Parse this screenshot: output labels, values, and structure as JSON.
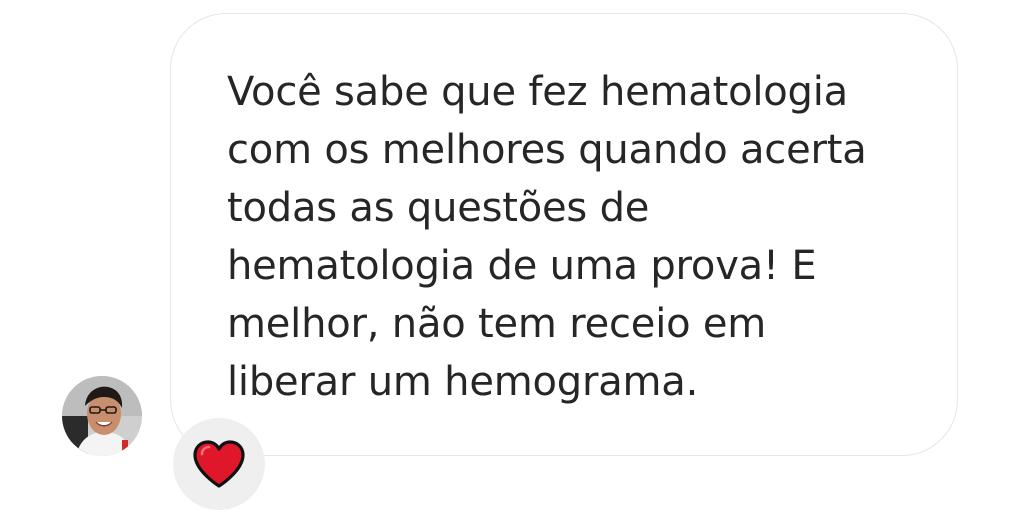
{
  "message": {
    "text": "Você sabe que fez hematologia\ncom os melhores quando acerta\ntodas as questões de\nhematologia de uma prova! E\nmelhor, não tem receio em\nliberar um hemograma.",
    "reaction_icon": "heart-icon",
    "reaction_color": "#e0162b",
    "avatar_icon": "user-avatar"
  }
}
